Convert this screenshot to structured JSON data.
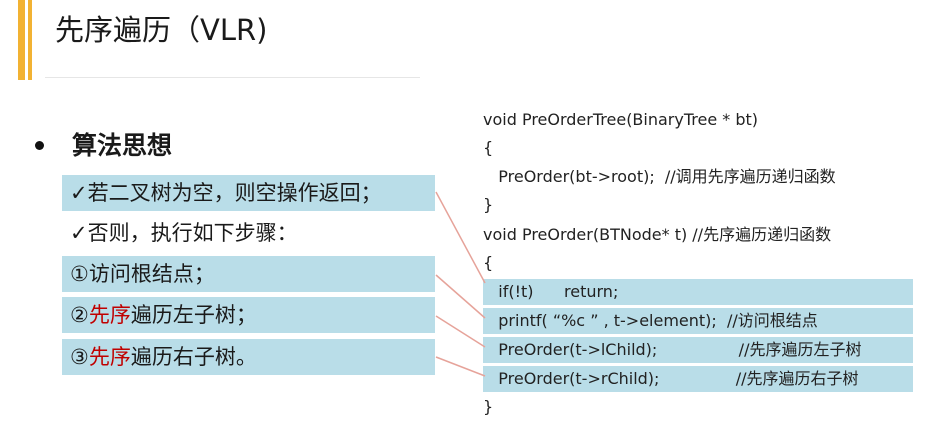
{
  "slide": {
    "title": "先序遍历（VLR)",
    "heading": "算法思想",
    "points": [
      {
        "text": "✓若二叉树为空，则空操作返回；"
      },
      {
        "text": "✓否则，执行如下步骤："
      }
    ],
    "steps": [
      {
        "num": "①",
        "prefix": "",
        "highlight": "",
        "rest": "访问根结点；"
      },
      {
        "num": "②",
        "prefix": "",
        "highlight": "先序",
        "rest": "遍历左子树；"
      },
      {
        "num": "③",
        "prefix": "",
        "highlight": "先序",
        "rest": "遍历右子树。"
      }
    ],
    "code": [
      "void PreOrderTree(BinaryTree * bt)",
      "{",
      "   PreOrder(bt->root);  //调用先序遍历递归函数",
      "}",
      "void PreOrder(BTNode* t) //先序遍历递归函数",
      "{",
      "   if(!t)      return;",
      "   printf( “%c ” , t->element);  //访问根结点",
      "   PreOrder(t->lChild);                //先序遍历左子树",
      "   PreOrder(t->rChild);               //先序遍历右子树",
      "}"
    ],
    "colors": {
      "accent": "#f2b233",
      "highlight_bg": "#b9dde8",
      "emphasis": "#c00000",
      "connector": "#e6a39a"
    }
  }
}
